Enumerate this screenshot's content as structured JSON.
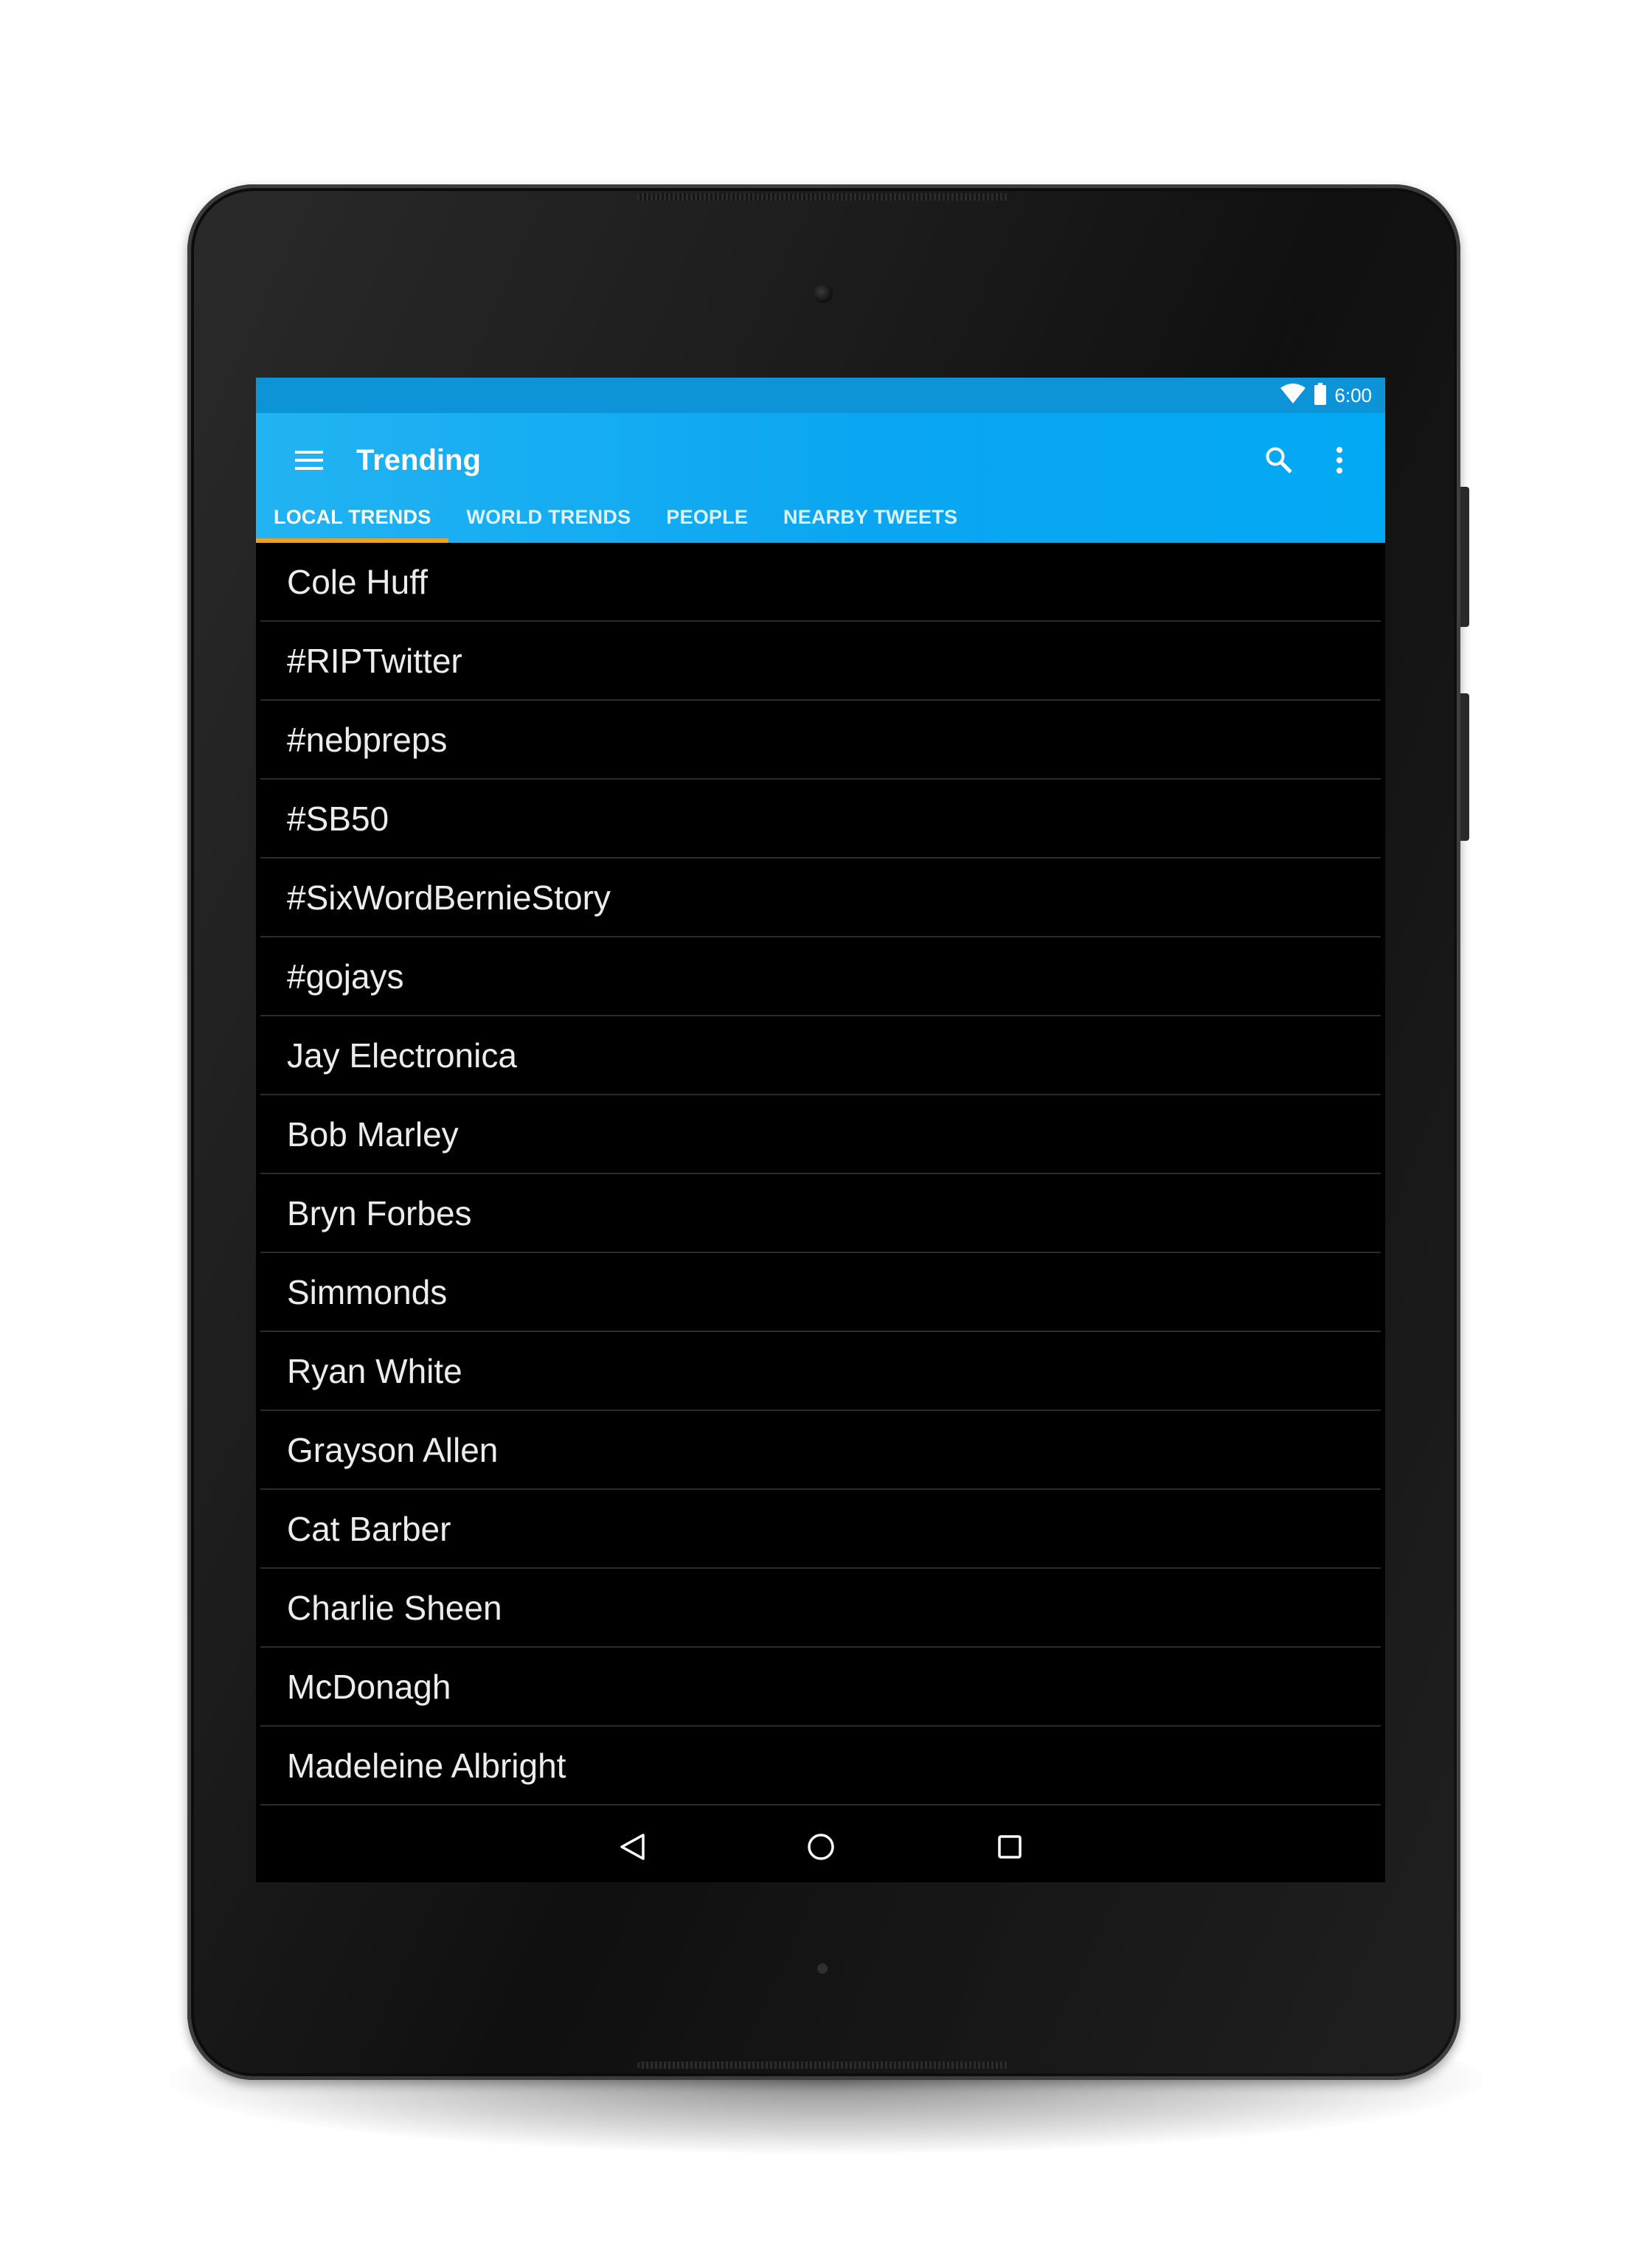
{
  "status_bar": {
    "time": "6:00"
  },
  "app_bar": {
    "title": "Trending",
    "background_color": "#03a9f4",
    "tab_indicator_color": "#f2a01a",
    "icons": {
      "menu": "menu-icon",
      "search": "search-icon",
      "overflow": "more-vert-icon"
    }
  },
  "tabs": [
    {
      "label": "LOCAL TRENDS",
      "active": true
    },
    {
      "label": "WORLD TRENDS",
      "active": false
    },
    {
      "label": "PEOPLE",
      "active": false
    },
    {
      "label": "NEARBY TWEETS",
      "active": false
    }
  ],
  "trends": [
    "Cole Huff",
    "#RIPTwitter",
    "#nebpreps",
    "#SB50",
    "#SixWordBernieStory",
    "#gojays",
    "Jay Electronica",
    "Bob Marley",
    "Bryn Forbes",
    "Simmonds",
    "Ryan White",
    "Grayson Allen",
    "Cat Barber",
    "Charlie Sheen",
    "McDonagh",
    "Madeleine Albright"
  ],
  "nav_bar": {
    "icons": [
      "back-icon",
      "home-icon",
      "recents-icon"
    ]
  }
}
